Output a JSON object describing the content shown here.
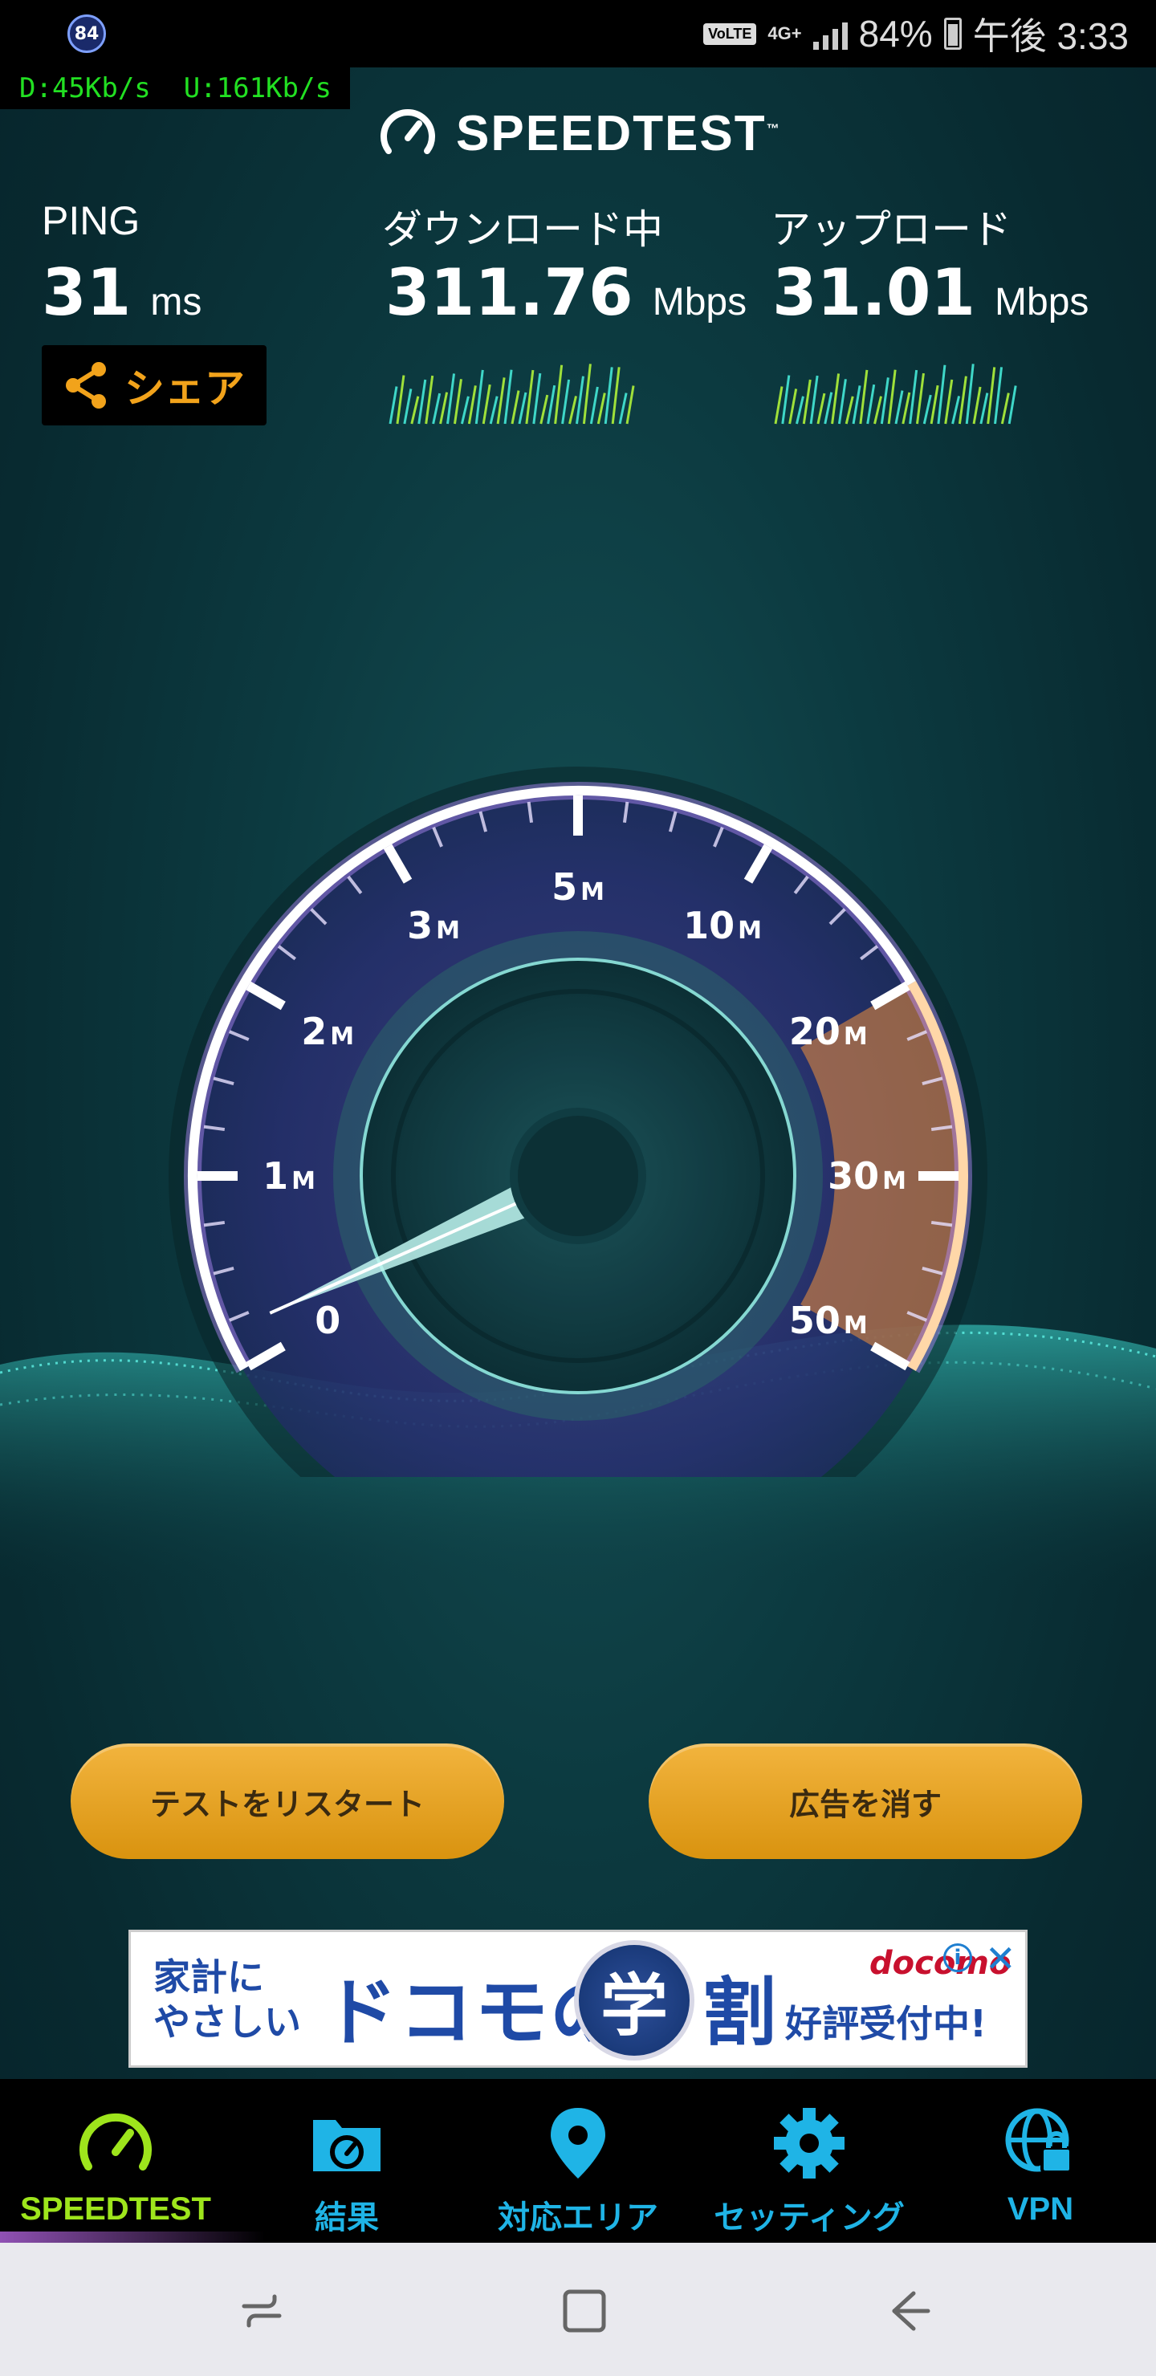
{
  "status_bar": {
    "notification_badge": "84",
    "volte": "VoLTE",
    "network_type": "4G+",
    "battery_percent": "84%",
    "time": "午後 3:33"
  },
  "net_speed_overlay": "D:45Kb/s  U:161Kb/s",
  "app": {
    "logo_text": "SPEEDTEST",
    "logo_tm": "™",
    "icon": "speedometer-icon"
  },
  "stats": {
    "ping": {
      "label": "PING",
      "value": "31",
      "unit": "ms"
    },
    "download": {
      "label": "ダウンロード中",
      "value": "311.76",
      "unit": "Mbps"
    },
    "upload": {
      "label": "アップロード",
      "value": "31.01",
      "unit": "Mbps"
    }
  },
  "share_button": {
    "label": "シェア",
    "icon": "share-icon"
  },
  "gauge": {
    "ticks": [
      {
        "value": "0",
        "unit": ""
      },
      {
        "value": "1",
        "unit": "M"
      },
      {
        "value": "2",
        "unit": "M"
      },
      {
        "value": "3",
        "unit": "M"
      },
      {
        "value": "5",
        "unit": "M"
      },
      {
        "value": "10",
        "unit": "M"
      },
      {
        "value": "20",
        "unit": "M"
      },
      {
        "value": "30",
        "unit": "M"
      },
      {
        "value": "50",
        "unit": "M"
      }
    ],
    "needle_tick_index": 0.2,
    "active_range_from_index": 6,
    "accent_color": "#f0903a",
    "arc_color": "#b58cff"
  },
  "buttons": {
    "restart": "テストをリスタート",
    "remove_ads": "広告を消す"
  },
  "ad": {
    "left_line1": "家計に",
    "left_line2": "やさしい",
    "main": "ドコモの",
    "badge": "学",
    "badge_suffix": "割",
    "right": "好評受付中!",
    "brand": "docomo"
  },
  "bottom_nav": [
    {
      "label": "SPEEDTEST",
      "icon": "speedometer-icon",
      "active": true
    },
    {
      "label": "結果",
      "icon": "results-folder-icon",
      "active": false
    },
    {
      "label": "対応エリア",
      "icon": "map-pin-icon",
      "active": false
    },
    {
      "label": "セッティング",
      "icon": "gear-icon",
      "active": false
    },
    {
      "label": "VPN",
      "icon": "vpn-globe-lock-icon",
      "active": false
    }
  ],
  "system_nav": {
    "recents": "recents-icon",
    "home": "home-icon",
    "back": "back-icon"
  }
}
